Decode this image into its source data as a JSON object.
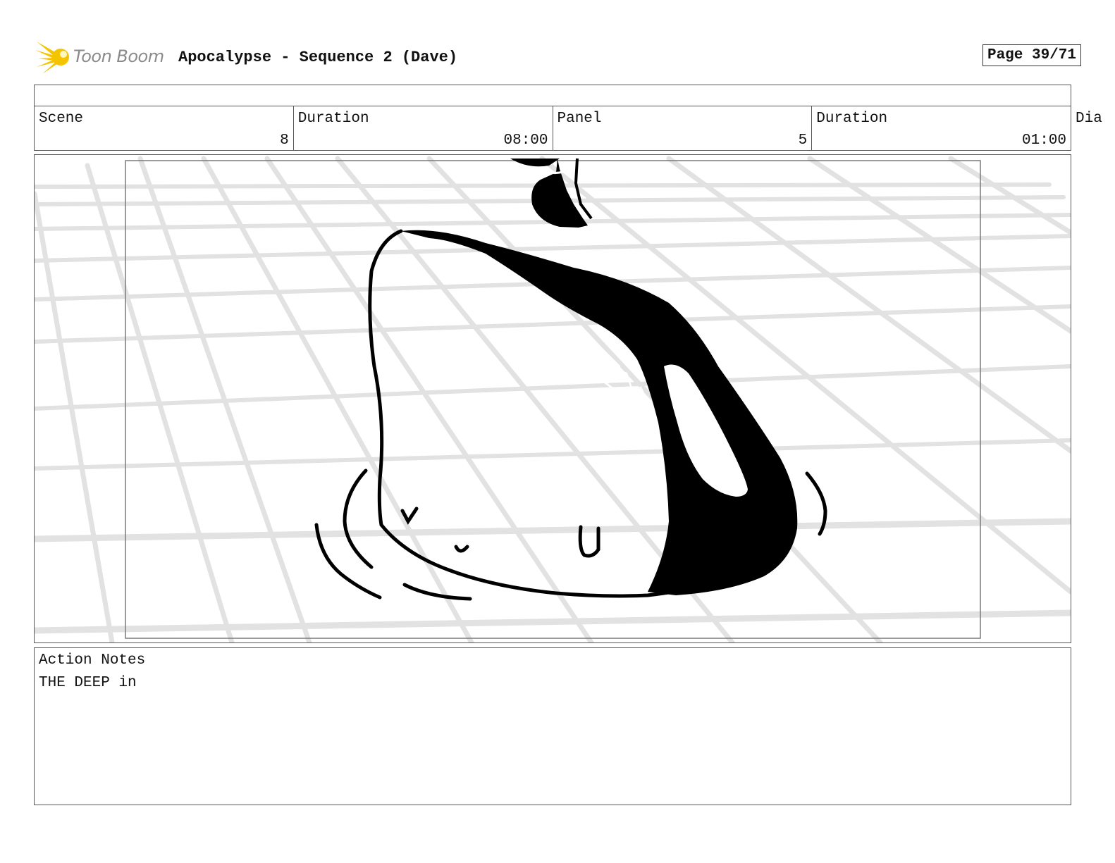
{
  "header": {
    "logo_text": "Toon Boom",
    "title": "Apocalypse - Sequence 2 (Dave)",
    "page_label": "Page 39/71"
  },
  "info": {
    "scene_label": "Scene",
    "scene_value": "8",
    "scene_duration_label": "Duration",
    "scene_duration_value": "08:00",
    "panel_label": "Panel",
    "panel_value": "5",
    "panel_duration_label": "Duration",
    "panel_duration_value": "01:00",
    "dialog_label_partial": "Dia"
  },
  "notes": {
    "label": "Action Notes",
    "text": "THE DEEP in"
  },
  "icons": {
    "logo": "toon-boom-logo-icon"
  },
  "colors": {
    "logo_yellow": "#f5c400",
    "logo_text": "#8a8a8a",
    "grid_gray": "#e2e2e2",
    "ink": "#000000"
  }
}
